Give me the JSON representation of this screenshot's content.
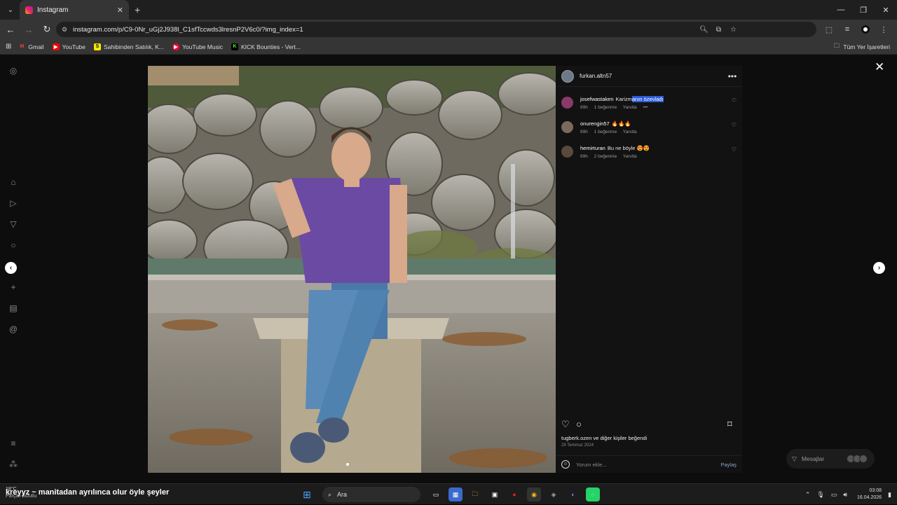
{
  "browser": {
    "tab_title": "Instagram",
    "url": "instagram.com/p/C9-0Nr_uGj2J938l_C1sfTccwds3lresnP2V6c0/?img_index=1",
    "bookmarks": [
      {
        "label": "Gmail",
        "icon": "gmail-icon",
        "color": "#ea4335"
      },
      {
        "label": "YouTube",
        "icon": "youtube-icon",
        "color": "#ff0000"
      },
      {
        "label": "Sahibinden Satılık, K...",
        "icon": "sahibinden-icon",
        "color": "#ffe800"
      },
      {
        "label": "YouTube Music",
        "icon": "youtube-music-icon",
        "color": "#ff0033"
      },
      {
        "label": "KICK Bounties - Vert...",
        "icon": "kick-icon",
        "color": "#53fc18"
      }
    ],
    "all_bookmarks_label": "Tüm Yer İşaretleri"
  },
  "post": {
    "username": "furkan.altn57",
    "comments": [
      {
        "user": "josefwastaken",
        "text_before": "Karizm",
        "text_highlight": "anın özevladı",
        "text": "",
        "time": "89h",
        "likes": "1 beğenme",
        "reply": "Yanıtla",
        "more": "•••",
        "avatar_color": "#8a3a6a"
      },
      {
        "user": "onurengin57",
        "text": "🔥🔥🔥",
        "time": "89h",
        "likes": "1 beğenme",
        "reply": "Yanıtla",
        "avatar_color": "#7a6a5a"
      },
      {
        "user": "hemirturan",
        "text": "Bu ne böyle 😍😍",
        "time": "89h",
        "likes": "2 beğenme",
        "reply": "Yanıtla",
        "avatar_color": "#5a4a3a"
      }
    ],
    "liked_by": "tugberk.ozen ve diğer kişiler beğendi",
    "date": "29 Temmuz 2024",
    "add_comment_placeholder": "Yorum ekle...",
    "share_label": "Paylaş",
    "messages_label": "Mesajlar"
  },
  "taskbar": {
    "weather_temp": "18°C",
    "weather_desc": "Parçalı bulutlu",
    "lyric": "kreyyz ~ manitadan ayrılınca olur öyle şeyler",
    "search_placeholder": "Ara",
    "time": "03:08",
    "date": "16.04.2026"
  }
}
